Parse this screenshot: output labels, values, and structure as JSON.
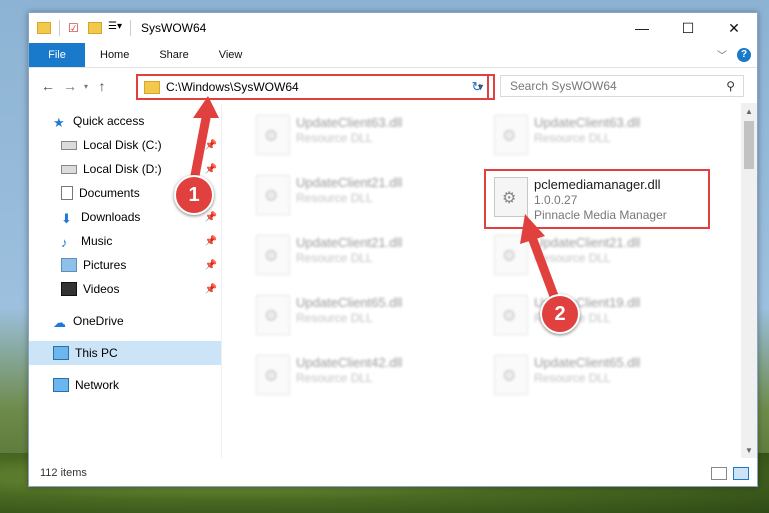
{
  "window": {
    "title": "SysWOW64"
  },
  "controls": {
    "minimize": "—",
    "maximize": "☐",
    "close": "✕"
  },
  "ribbon": {
    "tabs": [
      "File",
      "Home",
      "Share",
      "View"
    ],
    "help": "?"
  },
  "address": {
    "path": "C:\\Windows\\SysWOW64",
    "search_placeholder": "Search SysWOW64"
  },
  "sidebar": {
    "items": [
      {
        "label": "Quick access"
      },
      {
        "label": "Local Disk (C:)"
      },
      {
        "label": "Local Disk (D:)"
      },
      {
        "label": "Documents"
      },
      {
        "label": "Downloads"
      },
      {
        "label": "Music"
      },
      {
        "label": "Pictures"
      },
      {
        "label": "Videos"
      },
      {
        "label": "OneDrive"
      },
      {
        "label": "This PC"
      },
      {
        "label": "Network"
      }
    ]
  },
  "files": {
    "left": [
      {
        "name": "UpdateClient63.dll",
        "type": "Resource DLL"
      },
      {
        "name": "UpdateClient21.dll",
        "type": "Resource DLL"
      },
      {
        "name": "UpdateClient21.dll",
        "type": "Resource DLL"
      },
      {
        "name": "UpdateClient65.dll",
        "type": "Resource DLL"
      },
      {
        "name": "UpdateClient42.dll",
        "type": "Resource DLL"
      }
    ],
    "right": [
      {
        "name": "UpdateClient63.dll",
        "type": "Resource DLL"
      },
      {
        "name": "UpdateClient21.dll",
        "type": "Resource DLL"
      },
      {
        "name": "UpdateClient19.dll",
        "type": "Resource DLL"
      },
      {
        "name": "UpdateClient65.dll",
        "type": "Resource DLL"
      }
    ],
    "highlighted": {
      "name": "pclemediamanager.dll",
      "version": "1.0.0.27",
      "description": "Pinnacle Media Manager"
    }
  },
  "status": {
    "count": "112 items"
  },
  "annotations": {
    "step1": "1",
    "step2": "2"
  },
  "colors": {
    "accent": "#1979ca",
    "highlight": "#e0413e"
  }
}
